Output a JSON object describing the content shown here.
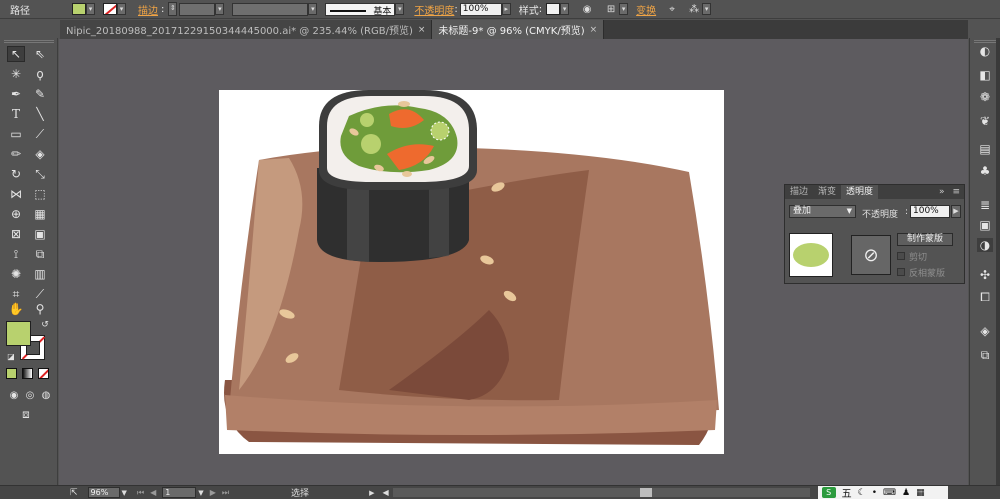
{
  "control_bar": {
    "object_type": "路径",
    "fill_color": "#b8d16e",
    "stroke_label": "描边",
    "stroke_style": "基本",
    "opacity_label": "不透明度",
    "opacity_value": "100%",
    "style_label": "样式",
    "transform_label": "变换"
  },
  "tabs": [
    {
      "label": "Nipic_20180988_20171229150344445000.ai* @ 235.44% (RGB/预览)",
      "close": "×"
    },
    {
      "label": "未标题-9* @ 96% (CMYK/预览)",
      "close": "×"
    }
  ],
  "transparency_panel": {
    "tabs": [
      "描边",
      "渐变",
      "透明度"
    ],
    "blend_mode": "叠加",
    "opacity_label": "不透明度",
    "opacity_value": "100%",
    "make_mask_label": "制作蒙版",
    "clip_label": "剪切",
    "invert_mask_label": "反相蒙版"
  },
  "status_bar": {
    "zoom": "96%",
    "artboard_number": "1",
    "current_tool": "选择"
  },
  "tray": {
    "ime_label": "五"
  },
  "colors": {
    "fill": "#b8d16e",
    "accent_link": "#f0a445",
    "board": "#a87760",
    "board_dark": "#8a5542",
    "nori": "#3a3a3a"
  }
}
